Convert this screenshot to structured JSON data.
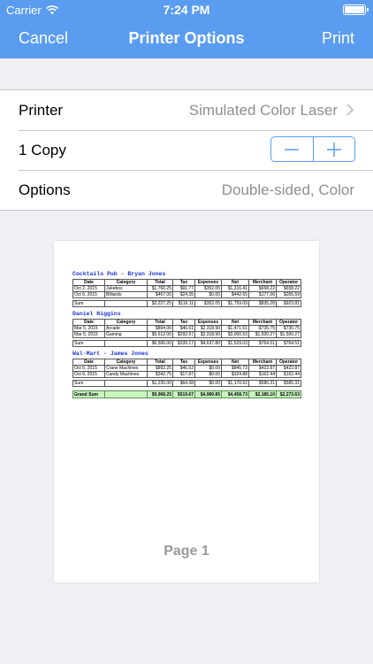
{
  "status": {
    "carrier": "Carrier",
    "time": "7:24 PM",
    "battery_level": 1.0
  },
  "nav": {
    "cancel": "Cancel",
    "title": "Printer Options",
    "print": "Print"
  },
  "options": {
    "printer": {
      "label": "Printer",
      "value": "Simulated Color Laser"
    },
    "copies": {
      "label": "1 Copy",
      "count": 1
    },
    "options": {
      "label": "Options",
      "value": "Double-sided, Color"
    }
  },
  "colors": {
    "accent": "#5a9cf0",
    "section_title": "#1a33d9",
    "grand_sum_bg": "#c9f5c0",
    "background": "#efeff4"
  },
  "icons": {
    "printer_row": "chevron-right-icon",
    "decrement": "minus-icon",
    "increment": "plus-icon",
    "wifi": "wifi-icon",
    "battery": "battery-icon"
  },
  "preview": {
    "page_label": "Page 1",
    "columns": [
      "Date",
      "Category",
      "Total",
      "Tax",
      "Expenses",
      "Net",
      "Merchant",
      "Operator"
    ],
    "sections": [
      {
        "title": "Cocktails Pub - Bryan Jones",
        "rows": [
          [
            "Oct 2, 2015",
            "Jukebox",
            "$1,760.25",
            "$91.77",
            "$352.05",
            "$1,316.41",
            "$658.22",
            "$658.22"
          ],
          [
            "Oct 6, 2015",
            "Billiards",
            "$467.00",
            "$24.35",
            "$0.00",
            "$442.65",
            "$177.06",
            "$265.59"
          ]
        ],
        "sum": [
          "Sum",
          "",
          "$2,227.25",
          "$116.11",
          "$352.05",
          "$1,759.09",
          "$835.28",
          "$923.81"
        ]
      },
      {
        "title": "Daniel Higgins",
        "rows": [
          [
            "Mar 5, 2015",
            "Arcade",
            "$894.00",
            "$46.61",
            "$2,318.90",
            "-$1,471.51",
            "-$735.75",
            "-$735.75"
          ],
          [
            "Mar 5, 2015",
            "Gaming",
            "$5,612.00",
            "$292.57",
            "$2,318.90",
            "$3,000.53",
            "$1,500.27",
            "$1,500.27"
          ]
        ],
        "sum": [
          "Sum",
          "",
          "$6,506.00",
          "$339.17",
          "$4,637.80",
          "$1,529.03",
          "$764.51",
          "$764.51"
        ]
      },
      {
        "title": "Wal-Mart - James Jones",
        "rows": [
          [
            "Oct 6, 2015",
            "Crane Machines",
            "$892.25",
            "$46.52",
            "$0.00",
            "$845.73",
            "$422.87",
            "$422.87"
          ],
          [
            "Oct 6, 2015",
            "Candy Machines",
            "$342.75",
            "$17.87",
            "$0.00",
            "$324.88",
            "$162.44",
            "$162.44"
          ]
        ],
        "sum": [
          "Sum",
          "",
          "$1,235.00",
          "$64.38",
          "$0.00",
          "$1,170.62",
          "$585.31",
          "$585.31"
        ]
      }
    ],
    "grand_sum": [
      "Grand Sum",
      "",
      "$9,968.25",
      "$519.67",
      "$4,989.85",
      "$4,458.73",
      "$2,185.10",
      "$2,273.63"
    ]
  }
}
